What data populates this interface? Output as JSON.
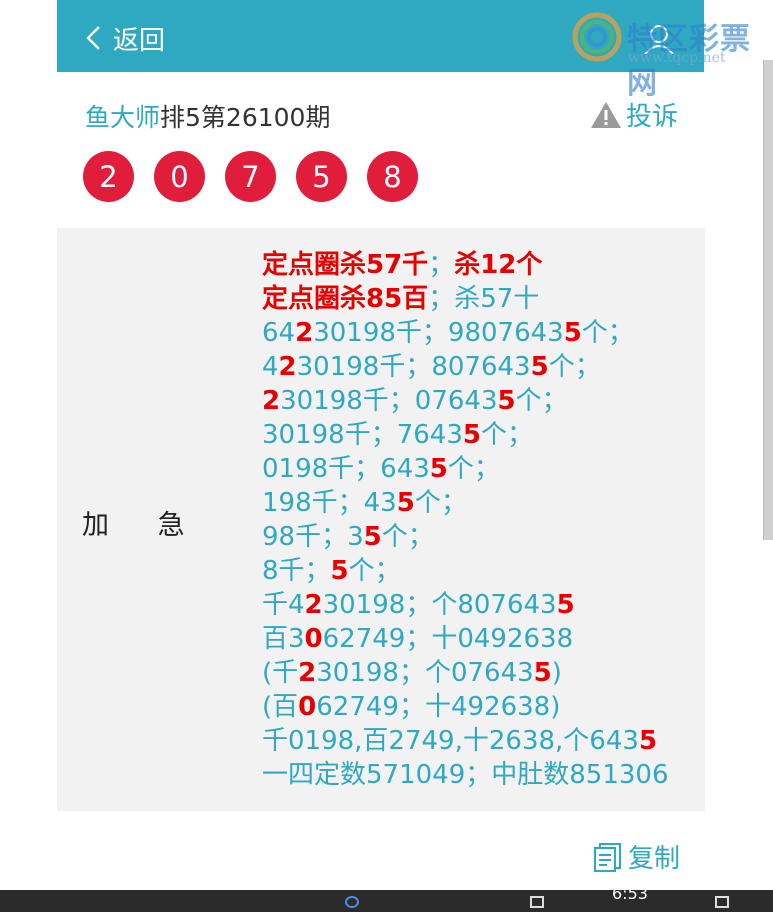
{
  "header": {
    "back_label": "返回"
  },
  "logo": {
    "name": "特区彩票网",
    "url": "www.tqcp.net"
  },
  "post": {
    "author": "鱼大师",
    "title_rest": "排5第26100期",
    "complain_label": "投诉",
    "balls": [
      "2",
      "0",
      "7",
      "5",
      "8"
    ]
  },
  "panel": {
    "label": "加 急",
    "lines": [
      [
        {
          "t": "定点圈杀57千",
          "r": true
        },
        {
          "t": "；"
        },
        {
          "t": "杀12个",
          "r": true
        }
      ],
      [
        {
          "t": "定点圈杀85百",
          "r": true
        },
        {
          "t": "；杀57十"
        }
      ],
      [
        {
          "t": "64"
        },
        {
          "t": "2",
          "r": true
        },
        {
          "t": "30198千；980764"
        },
        {
          "t": "3"
        },
        {
          "t": "5",
          "r": true
        },
        {
          "t": "个；"
        }
      ],
      [
        {
          "t": "4"
        },
        {
          "t": "2",
          "r": true
        },
        {
          "t": "30198千；807643"
        },
        {
          "t": "5",
          "r": true
        },
        {
          "t": "个；"
        }
      ],
      [
        {
          "t": "2",
          "r": true
        },
        {
          "t": "30198千；07643"
        },
        {
          "t": "5",
          "r": true
        },
        {
          "t": "个；"
        }
      ],
      [
        {
          "t": "30198千；7643"
        },
        {
          "t": "5",
          "r": true
        },
        {
          "t": "个；"
        }
      ],
      [
        {
          "t": "0198千；643"
        },
        {
          "t": "5",
          "r": true
        },
        {
          "t": "个；"
        }
      ],
      [
        {
          "t": "198千；43"
        },
        {
          "t": "5",
          "r": true
        },
        {
          "t": "个；"
        }
      ],
      [
        {
          "t": "98千；3"
        },
        {
          "t": "5",
          "r": true
        },
        {
          "t": "个；"
        }
      ],
      [
        {
          "t": "8千；"
        },
        {
          "t": "5",
          "r": true
        },
        {
          "t": "个；"
        }
      ],
      [
        {
          "t": "千4"
        },
        {
          "t": "2",
          "r": true
        },
        {
          "t": "30198；个807643"
        },
        {
          "t": "5",
          "r": true
        }
      ],
      [
        {
          "t": "百3"
        },
        {
          "t": "0",
          "r": true
        },
        {
          "t": "62749；十0492638"
        }
      ],
      [
        {
          "t": "(千"
        },
        {
          "t": "2",
          "r": true
        },
        {
          "t": "30198；个07643"
        },
        {
          "t": "5",
          "r": true
        },
        {
          "t": ")"
        }
      ],
      [
        {
          "t": "(百"
        },
        {
          "t": "0",
          "r": true
        },
        {
          "t": "62749；十492638)"
        }
      ],
      [
        {
          "t": "千0198,百2749,十2638,个643"
        },
        {
          "t": "5",
          "r": true
        }
      ],
      [
        {
          "t": "一四定数571049；中肚数851306"
        }
      ]
    ]
  },
  "copy_label": "复制",
  "taskbar": {
    "time": "6:53"
  },
  "colors": {
    "accent": "#2fa9c1",
    "ball": "#e11d3c",
    "highlight": "#e60000"
  }
}
